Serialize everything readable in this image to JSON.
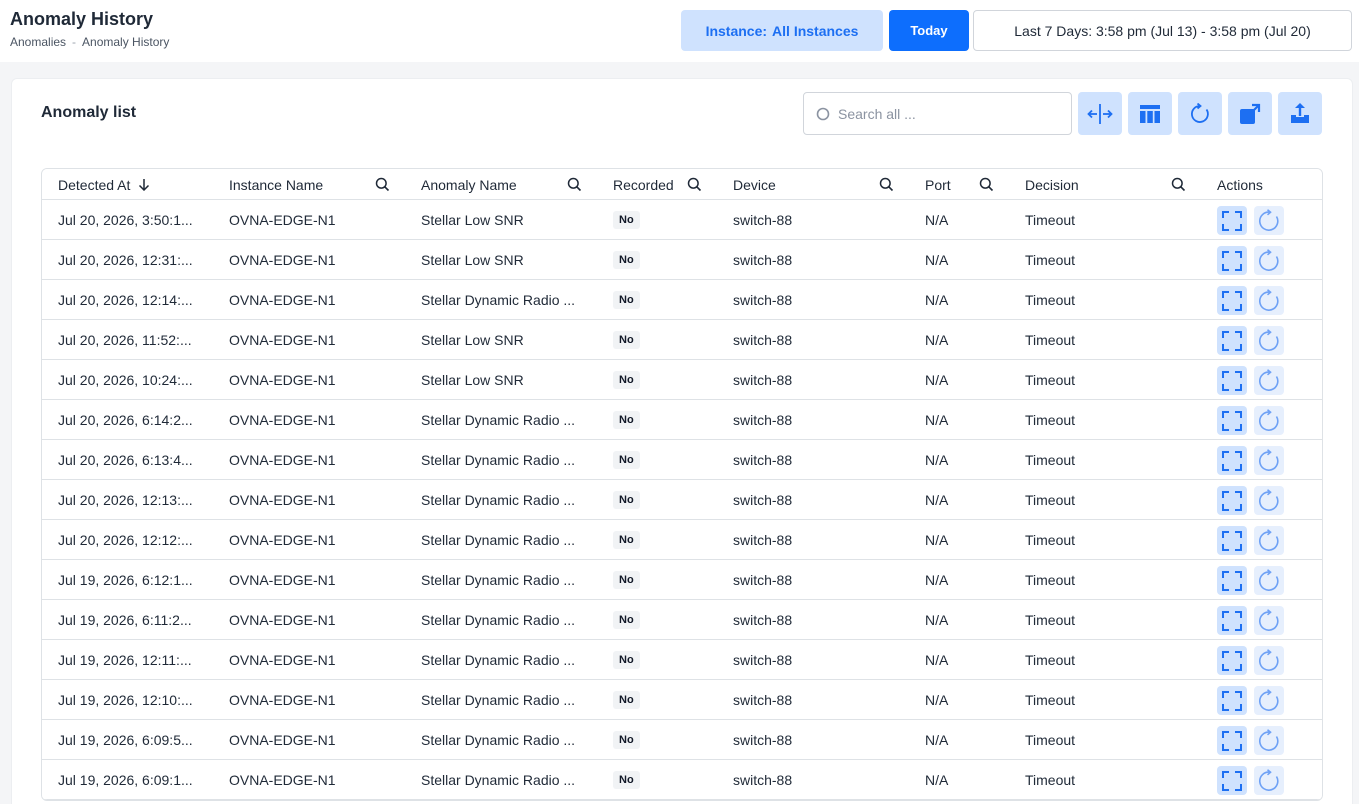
{
  "header": {
    "title": "Anomaly History",
    "breadcrumb": [
      "Anomalies",
      "-",
      "Anomaly History"
    ],
    "instance_prefix": "Instance:",
    "instance_value": "All Instances",
    "today_label": "Today",
    "range_label": "Last 7 Days: 3:58 pm (Jul 13) - 3:58 pm (Jul 20)"
  },
  "card": {
    "title": "Anomaly list",
    "search_placeholder": "Search all ..."
  },
  "toolbar_icons": [
    "resize-columns-icon",
    "columns-icon",
    "refresh-icon",
    "open-external-icon",
    "export-icon"
  ],
  "columns": [
    "Detected At",
    "Instance Name",
    "Anomaly Name",
    "Recorded",
    "Device",
    "Port",
    "Decision",
    "Actions"
  ],
  "sort": {
    "column": "Detected At",
    "direction": "desc"
  },
  "rows": [
    {
      "detected": "Jul 20, 2026, 3:50:1...",
      "instance": "OVNA-EDGE-N1",
      "anomaly": "Stellar Low SNR",
      "recorded": "No",
      "device": "switch-88",
      "port": "N/A",
      "decision": "Timeout"
    },
    {
      "detected": "Jul 20, 2026, 12:31:...",
      "instance": "OVNA-EDGE-N1",
      "anomaly": "Stellar Low SNR",
      "recorded": "No",
      "device": "switch-88",
      "port": "N/A",
      "decision": "Timeout"
    },
    {
      "detected": "Jul 20, 2026, 12:14:...",
      "instance": "OVNA-EDGE-N1",
      "anomaly": "Stellar Dynamic Radio ...",
      "recorded": "No",
      "device": "switch-88",
      "port": "N/A",
      "decision": "Timeout"
    },
    {
      "detected": "Jul 20, 2026, 11:52:...",
      "instance": "OVNA-EDGE-N1",
      "anomaly": "Stellar Low SNR",
      "recorded": "No",
      "device": "switch-88",
      "port": "N/A",
      "decision": "Timeout"
    },
    {
      "detected": "Jul 20, 2026, 10:24:...",
      "instance": "OVNA-EDGE-N1",
      "anomaly": "Stellar Low SNR",
      "recorded": "No",
      "device": "switch-88",
      "port": "N/A",
      "decision": "Timeout"
    },
    {
      "detected": "Jul 20, 2026, 6:14:2...",
      "instance": "OVNA-EDGE-N1",
      "anomaly": "Stellar Dynamic Radio ...",
      "recorded": "No",
      "device": "switch-88",
      "port": "N/A",
      "decision": "Timeout"
    },
    {
      "detected": "Jul 20, 2026, 6:13:4...",
      "instance": "OVNA-EDGE-N1",
      "anomaly": "Stellar Dynamic Radio ...",
      "recorded": "No",
      "device": "switch-88",
      "port": "N/A",
      "decision": "Timeout"
    },
    {
      "detected": "Jul 20, 2026, 12:13:...",
      "instance": "OVNA-EDGE-N1",
      "anomaly": "Stellar Dynamic Radio ...",
      "recorded": "No",
      "device": "switch-88",
      "port": "N/A",
      "decision": "Timeout"
    },
    {
      "detected": "Jul 20, 2026, 12:12:...",
      "instance": "OVNA-EDGE-N1",
      "anomaly": "Stellar Dynamic Radio ...",
      "recorded": "No",
      "device": "switch-88",
      "port": "N/A",
      "decision": "Timeout"
    },
    {
      "detected": "Jul 19, 2026, 6:12:1...",
      "instance": "OVNA-EDGE-N1",
      "anomaly": "Stellar Dynamic Radio ...",
      "recorded": "No",
      "device": "switch-88",
      "port": "N/A",
      "decision": "Timeout"
    },
    {
      "detected": "Jul 19, 2026, 6:11:2...",
      "instance": "OVNA-EDGE-N1",
      "anomaly": "Stellar Dynamic Radio ...",
      "recorded": "No",
      "device": "switch-88",
      "port": "N/A",
      "decision": "Timeout"
    },
    {
      "detected": "Jul 19, 2026, 12:11:...",
      "instance": "OVNA-EDGE-N1",
      "anomaly": "Stellar Dynamic Radio ...",
      "recorded": "No",
      "device": "switch-88",
      "port": "N/A",
      "decision": "Timeout"
    },
    {
      "detected": "Jul 19, 2026, 12:10:...",
      "instance": "OVNA-EDGE-N1",
      "anomaly": "Stellar Dynamic Radio ...",
      "recorded": "No",
      "device": "switch-88",
      "port": "N/A",
      "decision": "Timeout"
    },
    {
      "detected": "Jul 19, 2026, 6:09:5...",
      "instance": "OVNA-EDGE-N1",
      "anomaly": "Stellar Dynamic Radio ...",
      "recorded": "No",
      "device": "switch-88",
      "port": "N/A",
      "decision": "Timeout"
    },
    {
      "detected": "Jul 19, 2026, 6:09:1...",
      "instance": "OVNA-EDGE-N1",
      "anomaly": "Stellar Dynamic Radio ...",
      "recorded": "No",
      "device": "switch-88",
      "port": "N/A",
      "decision": "Timeout"
    }
  ],
  "row_action_icons": [
    "expand-icon",
    "replay-icon"
  ],
  "colors": {
    "accent": "#0d6efd",
    "accent_light": "#cfe2fe",
    "icon_blue": "#1d6ff2"
  }
}
